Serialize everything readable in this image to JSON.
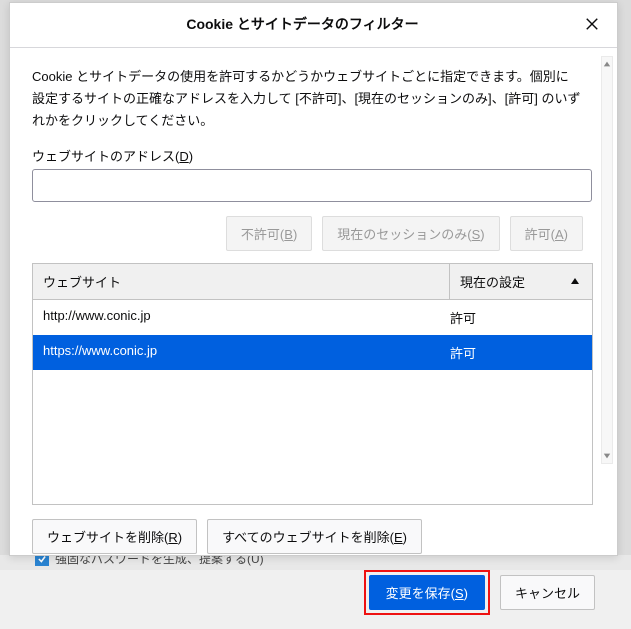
{
  "dialog": {
    "title": "Cookie とサイトデータのフィルター",
    "description": "Cookie とサイトデータの使用を許可するかどうかウェブサイトごとに指定できます。個別に設定するサイトの正確なアドレスを入力して [不許可]、[現在のセッションのみ]、[許可] のいずれかをクリックしてください。",
    "address_label_pre": "ウェブサイトのアドレス(",
    "address_label_key": "D",
    "address_label_post": ")",
    "address_value": "",
    "buttons": {
      "block_pre": "不許可(",
      "block_key": "B",
      "block_post": ")",
      "session_pre": "現在のセッションのみ(",
      "session_key": "S",
      "session_post": ")",
      "allow_pre": "許可(",
      "allow_key": "A",
      "allow_post": ")",
      "remove_pre": "ウェブサイトを削除(",
      "remove_key": "R",
      "remove_post": ")",
      "remove_all_pre": "すべてのウェブサイトを削除(",
      "remove_all_key": "E",
      "remove_all_post": ")",
      "save_pre": "変更を保存(",
      "save_key": "S",
      "save_post": ")",
      "cancel": "キャンセル"
    },
    "table": {
      "col_site": "ウェブサイト",
      "col_status": "現在の設定",
      "rows": [
        {
          "site": "http://www.conic.jp",
          "status": "許可",
          "selected": false
        },
        {
          "site": "https://www.conic.jp",
          "status": "許可",
          "selected": true
        }
      ]
    }
  },
  "backdrop": {
    "checkbox_text": "強固なパスワードを生成、提案する(U)"
  }
}
